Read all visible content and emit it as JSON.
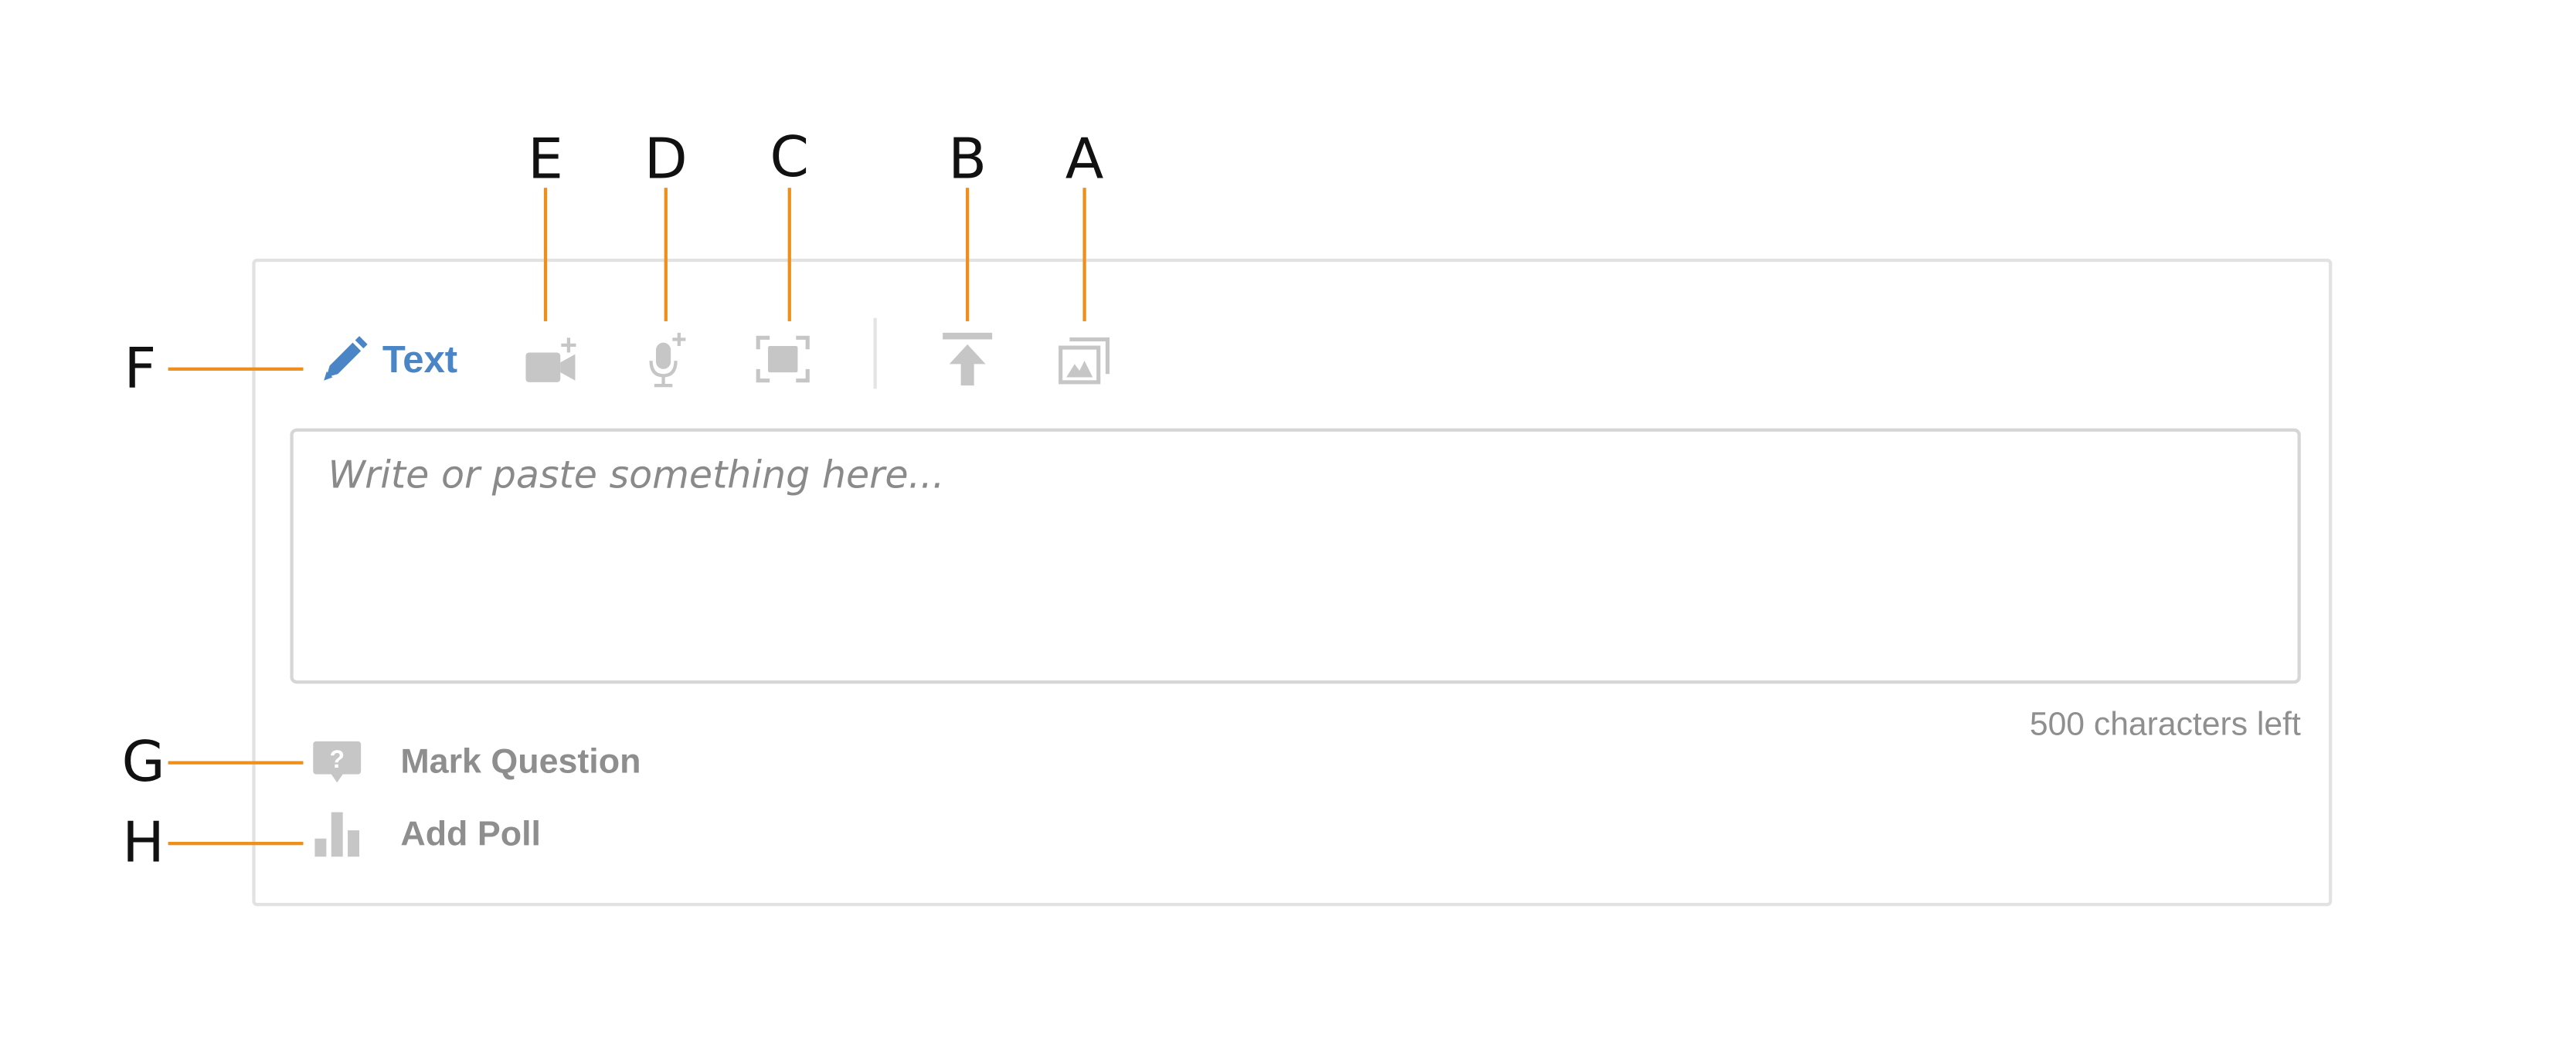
{
  "callouts": {
    "a": "A",
    "b": "B",
    "c": "C",
    "d": "D",
    "e": "E",
    "f": "F",
    "g": "G",
    "h": "H"
  },
  "toolbar": {
    "text_tab_label": "Text",
    "icons": {
      "text": "pencil-icon",
      "video": "video-camera-plus-icon",
      "audio": "microphone-plus-icon",
      "screen": "screen-capture-icon",
      "upload": "upload-icon",
      "gallery": "image-gallery-icon"
    }
  },
  "editor": {
    "placeholder": "Write or paste something here...",
    "char_counter": "500 characters left"
  },
  "options": {
    "mark_question": "Mark Question",
    "add_poll": "Add Poll"
  },
  "colors": {
    "accent": "#4a86c6",
    "callout_line": "#ef8f1b",
    "icon_gray": "#c6c6c6"
  }
}
